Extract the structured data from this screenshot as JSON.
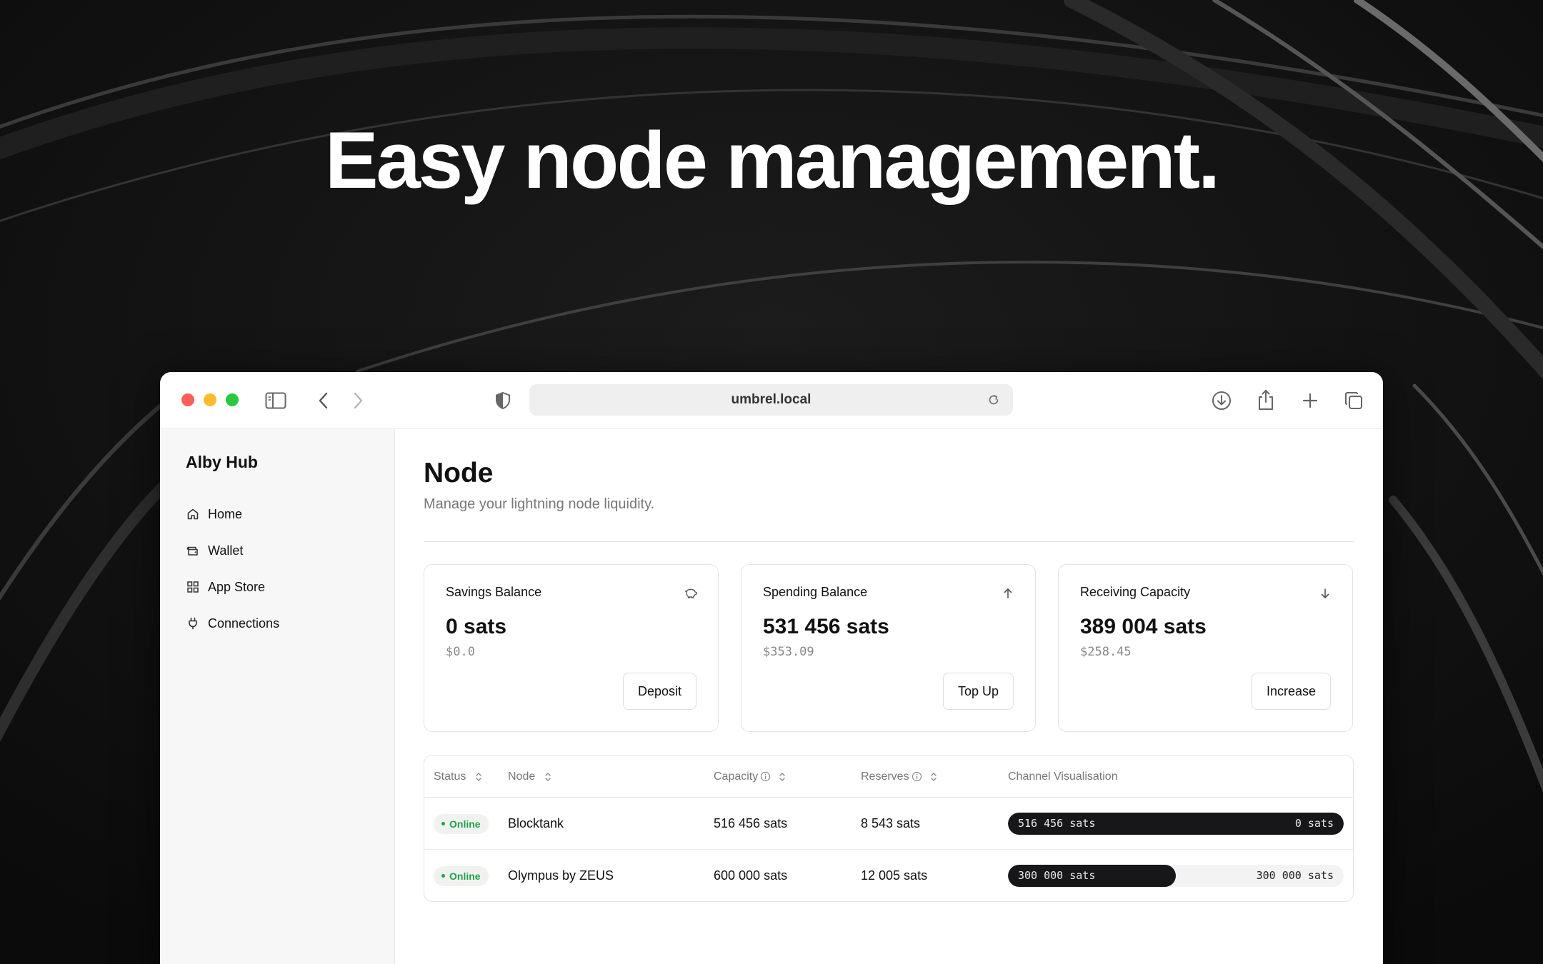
{
  "hero": {
    "title": "Easy node management."
  },
  "browser": {
    "url": "umbrel.local"
  },
  "sidebar": {
    "brand": "Alby Hub",
    "items": [
      {
        "label": "Home",
        "icon": "home-icon"
      },
      {
        "label": "Wallet",
        "icon": "wallet-icon"
      },
      {
        "label": "App Store",
        "icon": "grid-icon"
      },
      {
        "label": "Connections",
        "icon": "plug-icon"
      }
    ]
  },
  "page": {
    "title": "Node",
    "subtitle": "Manage your lightning node liquidity."
  },
  "cards": [
    {
      "title": "Savings Balance",
      "value": "0 sats",
      "fiat": "$0.0",
      "button": "Deposit",
      "icon": "piggy-bank-icon"
    },
    {
      "title": "Spending Balance",
      "value": "531 456 sats",
      "fiat": "$353.09",
      "button": "Top Up",
      "icon": "arrow-up-icon"
    },
    {
      "title": "Receiving Capacity",
      "value": "389 004 sats",
      "fiat": "$258.45",
      "button": "Increase",
      "icon": "arrow-down-icon"
    }
  ],
  "table": {
    "headers": {
      "status": "Status",
      "node": "Node",
      "capacity": "Capacity",
      "reserves": "Reserves",
      "visualisation": "Channel Visualisation"
    },
    "rows": [
      {
        "status": "Online",
        "node": "Blocktank",
        "capacity": "516 456 sats",
        "reserves": "8 543 sats",
        "local": "516 456 sats",
        "remote": "0 sats",
        "local_fraction": 1.0
      },
      {
        "status": "Online",
        "node": "Olympus by ZEUS",
        "capacity": "600 000 sats",
        "reserves": "12 005 sats",
        "local": "300 000 sats",
        "remote": "300 000 sats",
        "local_fraction": 0.5
      }
    ]
  },
  "colors": {
    "online": "#22a148",
    "bar_fill": "#17171a",
    "traffic_red": "#fe5f57",
    "traffic_yellow": "#febc2e",
    "traffic_green": "#28c840"
  }
}
